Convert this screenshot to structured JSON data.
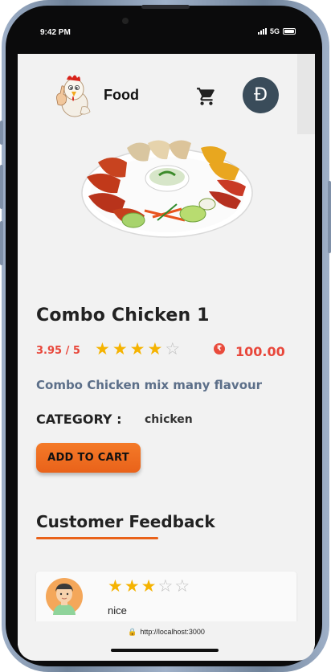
{
  "status_bar": {
    "time": "9:42 PM",
    "network": "5G"
  },
  "header": {
    "brand": "Food",
    "avatar_letter": "Đ"
  },
  "product": {
    "title": "Combo Chicken 1",
    "rating_text": "3.95 / 5",
    "rating": 4,
    "rating_max": 5,
    "currency_symbol": "₹",
    "price": "100.00",
    "description": "Combo Chicken mix many flavour",
    "category_label": "CATEGORY :",
    "category_value": "chicken",
    "add_to_cart_label": "ADD TO CART"
  },
  "feedback": {
    "title": "Customer Feedback",
    "reviews": [
      {
        "rating": 3,
        "rating_max": 5,
        "text": "nice"
      }
    ]
  },
  "browser": {
    "url": "http://localhost:3000"
  },
  "colors": {
    "accent": "#e9621a",
    "price_red": "#e8473b",
    "star": "#f5b301",
    "avatar_bg": "#3a4c5a",
    "desc_text": "#5c6f89"
  }
}
